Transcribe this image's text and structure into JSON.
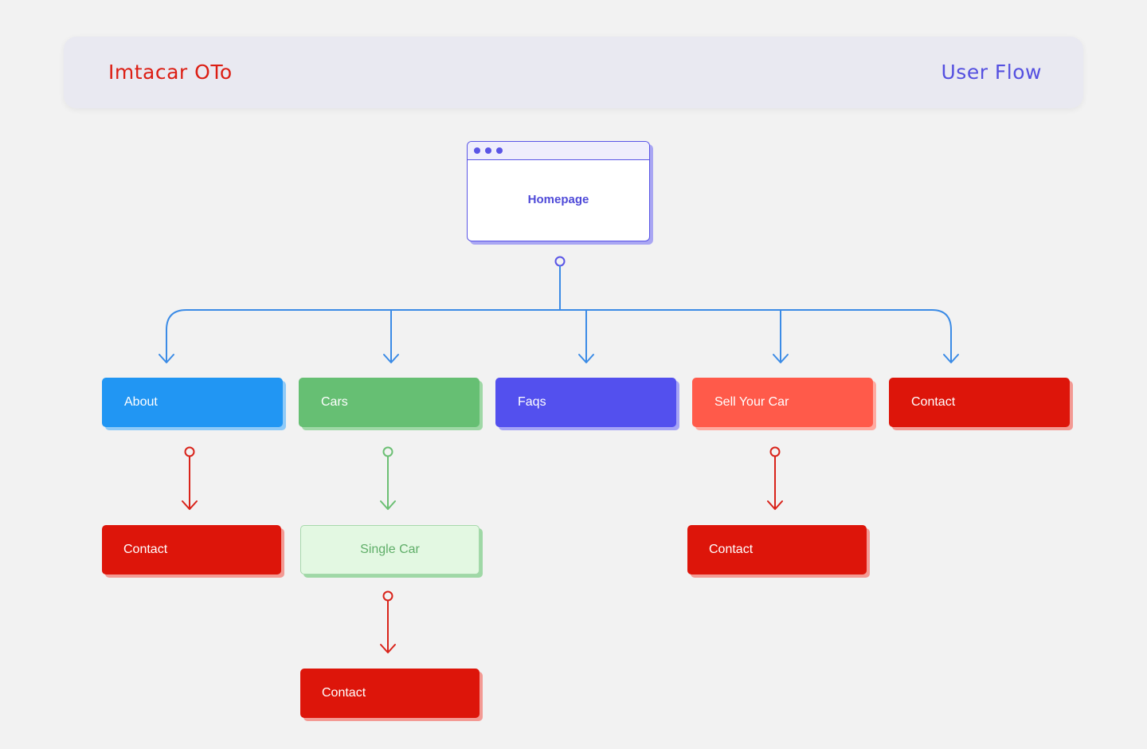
{
  "header": {
    "app_title": "Imtacar OTo",
    "page_label": "User Flow"
  },
  "root": {
    "label": "Homepage"
  },
  "nodes": {
    "about": "About",
    "cars": "Cars",
    "faqs": "Faqs",
    "sell_your_car": "Sell Your Car",
    "contact": "Contact",
    "about_contact": "Contact",
    "single_car": "Single Car",
    "single_car_contact": "Contact",
    "sell_contact": "Contact"
  },
  "edges": [
    {
      "from": "Homepage",
      "to": "About"
    },
    {
      "from": "Homepage",
      "to": "Cars"
    },
    {
      "from": "Homepage",
      "to": "Faqs"
    },
    {
      "from": "Homepage",
      "to": "Sell Your Car"
    },
    {
      "from": "Homepage",
      "to": "Contact"
    },
    {
      "from": "About",
      "to": "Contact"
    },
    {
      "from": "Cars",
      "to": "Single Car"
    },
    {
      "from": "Single Car",
      "to": "Contact"
    },
    {
      "from": "Sell Your Car",
      "to": "Contact"
    }
  ],
  "colors": {
    "background": "#f2f2f2",
    "header_bg": "#e9e9f1",
    "app_title": "#dc1e14",
    "page_label": "#5550e0",
    "root_border": "#5a55e6",
    "connector_blue": "#3b8be6",
    "connector_red": "#d9231a",
    "connector_green": "#6cbf74",
    "about": "#2196f3",
    "cars": "#66bf73",
    "faqs": "#5350ee",
    "sell_your_car": "#ff5a4a",
    "contact": "#dd150a",
    "single_car_bg": "#e3f8e2",
    "single_car_text": "#5fae68"
  }
}
